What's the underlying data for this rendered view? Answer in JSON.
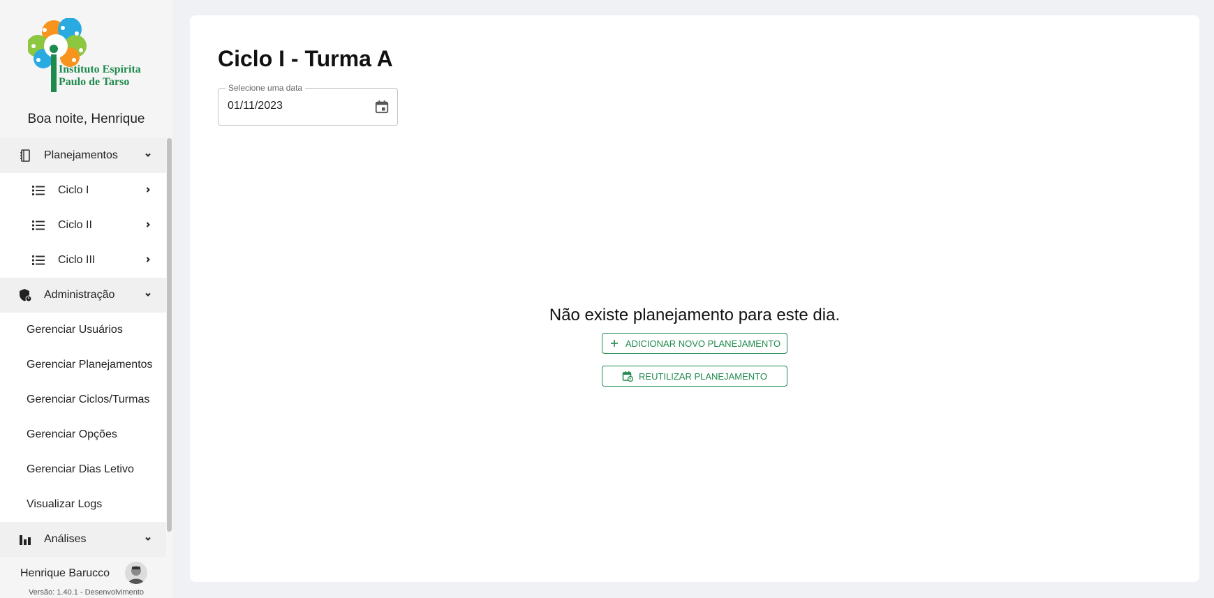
{
  "sidebar": {
    "logo": {
      "line1": "Instituto Espírita",
      "line2": "Paulo de Tarso",
      "icon": "tree-logo-icon",
      "colors": [
        "#f7941d",
        "#29abe2",
        "#8dc63f",
        "#1e8a4c"
      ]
    },
    "greeting": "Boa noite, Henrique",
    "menu": {
      "planejamentos": {
        "label": "Planejamentos",
        "icon": "notebook-icon"
      },
      "ciclos": [
        {
          "label": "Ciclo I",
          "icon": "list-icon"
        },
        {
          "label": "Ciclo II",
          "icon": "list-icon"
        },
        {
          "label": "Ciclo III",
          "icon": "list-icon"
        }
      ],
      "administracao": {
        "label": "Administração",
        "icon": "admin-shield-icon"
      },
      "admin_links": [
        "Gerenciar Usuários",
        "Gerenciar Planejamentos",
        "Gerenciar Ciclos/Turmas",
        "Gerenciar Opções",
        "Gerenciar Dias Letivo",
        "Visualizar Logs"
      ],
      "analises": {
        "label": "Análises",
        "icon": "bar-chart-icon"
      }
    },
    "user": {
      "name": "Henrique Barucco",
      "version": "Versão: 1.40.1 - Desenvolvimento"
    }
  },
  "main": {
    "title": "Ciclo I - Turma A",
    "date_picker": {
      "label": "Selecione uma data",
      "value": "01/11/2023",
      "icon": "calendar-icon"
    },
    "empty_message": "Não existe planejamento para este dia.",
    "add_button": {
      "label": "ADICIONAR NOVO PLANEJAMENTO",
      "icon": "plus-icon"
    },
    "reuse_button": {
      "label": "REUTILIZAR PLANEJAMENTO",
      "icon": "calendar-reuse-icon"
    }
  },
  "colors": {
    "accent": "#1e8a4c",
    "background": "#f0f1f5",
    "sidebar": "#f5f5f5"
  }
}
